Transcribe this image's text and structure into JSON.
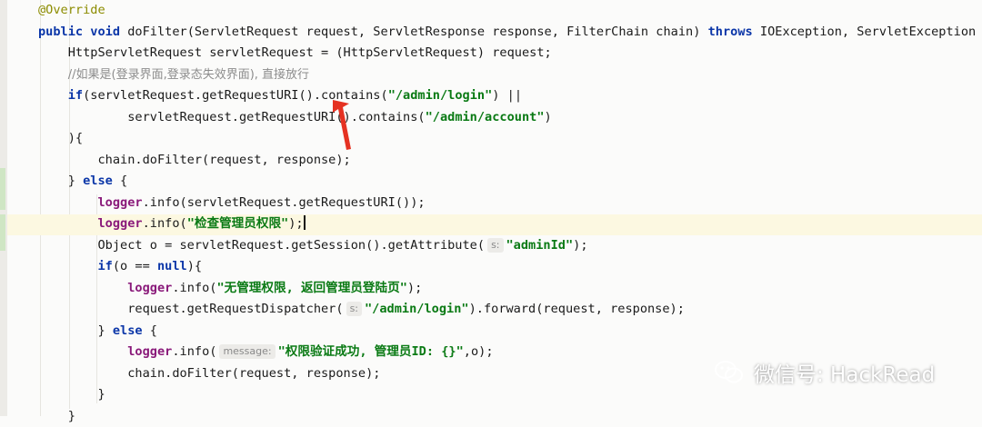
{
  "editor": {
    "lines": [
      {
        "segments": [
          {
            "t": "@Override",
            "c": "ann"
          }
        ]
      },
      {
        "segments": [
          {
            "t": "public ",
            "c": "kw"
          },
          {
            "t": "void ",
            "c": "kw"
          },
          {
            "t": "doFilter(ServletRequest request, ServletResponse response, FilterChain chain) ",
            "c": ""
          },
          {
            "t": "throws ",
            "c": "kw"
          },
          {
            "t": "IOException, ServletException {",
            "c": ""
          }
        ]
      },
      {
        "segments": [
          {
            "t": "    HttpServletRequest servletRequest = (HttpServletRequest) request;",
            "c": ""
          }
        ]
      },
      {
        "segments": [
          {
            "t": "    ",
            "c": ""
          },
          {
            "t": "//如果是(登录界面,登录态失效界面), 直接放行",
            "c": "cmt"
          }
        ]
      },
      {
        "segments": [
          {
            "t": "    ",
            "c": ""
          },
          {
            "t": "if",
            "c": "kw"
          },
          {
            "t": "(servletRequest.getRequestURI().contains(",
            "c": ""
          },
          {
            "t": "\"/admin/login\"",
            "c": "str"
          },
          {
            "t": ") ||",
            "c": ""
          }
        ]
      },
      {
        "segments": [
          {
            "t": "            servletRequest.getRequestURI().contains(",
            "c": ""
          },
          {
            "t": "\"/admin/account\"",
            "c": "str"
          },
          {
            "t": ")",
            "c": ""
          }
        ]
      },
      {
        "segments": [
          {
            "t": "    ){",
            "c": ""
          }
        ]
      },
      {
        "segments": [
          {
            "t": "        chain.doFilter(request, response);",
            "c": ""
          }
        ]
      },
      {
        "segments": [
          {
            "t": "    } ",
            "c": ""
          },
          {
            "t": "else",
            "c": "kw"
          },
          {
            "t": " {",
            "c": ""
          }
        ]
      },
      {
        "segments": [
          {
            "t": "        ",
            "c": ""
          },
          {
            "t": "logger",
            "c": "fld"
          },
          {
            "t": ".info(servletRequest.getRequestURI());",
            "c": ""
          }
        ]
      },
      {
        "segments": [
          {
            "t": "        ",
            "c": ""
          },
          {
            "t": "logger",
            "c": "fld"
          },
          {
            "t": ".info(",
            "c": ""
          },
          {
            "t": "\"检查管理员权限\"",
            "c": "str"
          },
          {
            "t": ");",
            "c": ""
          },
          {
            "cursor": true
          }
        ]
      },
      {
        "segments": [
          {
            "t": "        Object o = servletRequest.getSession().getAttribute(",
            "c": ""
          },
          {
            "hint": "s:"
          },
          {
            "t": "\"adminId\"",
            "c": "str"
          },
          {
            "t": ");",
            "c": ""
          }
        ]
      },
      {
        "segments": [
          {
            "t": "        ",
            "c": ""
          },
          {
            "t": "if",
            "c": "kw"
          },
          {
            "t": "(o == ",
            "c": ""
          },
          {
            "t": "null",
            "c": "kw"
          },
          {
            "t": "){",
            "c": ""
          }
        ]
      },
      {
        "segments": [
          {
            "t": "            ",
            "c": ""
          },
          {
            "t": "logger",
            "c": "fld"
          },
          {
            "t": ".info(",
            "c": ""
          },
          {
            "t": "\"无管理权限, 返回管理员登陆页\"",
            "c": "str"
          },
          {
            "t": ");",
            "c": ""
          }
        ]
      },
      {
        "segments": [
          {
            "t": "            request.getRequestDispatcher(",
            "c": ""
          },
          {
            "hint": "s:"
          },
          {
            "t": "\"/admin/login\"",
            "c": "str"
          },
          {
            "t": ").forward(request, response);",
            "c": ""
          }
        ]
      },
      {
        "segments": [
          {
            "t": "        } ",
            "c": ""
          },
          {
            "t": "else",
            "c": "kw"
          },
          {
            "t": " {",
            "c": ""
          }
        ]
      },
      {
        "segments": [
          {
            "t": "            ",
            "c": ""
          },
          {
            "t": "logger",
            "c": "fld"
          },
          {
            "t": ".info(",
            "c": ""
          },
          {
            "hint": "message:"
          },
          {
            "t": "\"权限验证成功, 管理员ID: {}\"",
            "c": "str"
          },
          {
            "t": ",o);",
            "c": ""
          }
        ]
      },
      {
        "segments": [
          {
            "t": "            chain.doFilter(request, response);",
            "c": ""
          }
        ]
      },
      {
        "segments": [
          {
            "t": "        }",
            "c": ""
          }
        ]
      },
      {
        "segments": [
          {
            "t": "    }",
            "c": ""
          }
        ]
      }
    ]
  },
  "watermark": {
    "text": "微信号: HackRead",
    "icon": "wechat-icon"
  },
  "colors": {
    "keyword": "#0b36a8",
    "string": "#0a7a14",
    "field": "#8a1a7a",
    "annotation": "#8c8c00",
    "comment": "#8c8c8c",
    "arrow": "#e53222",
    "current_line": "#fcf8e1"
  }
}
